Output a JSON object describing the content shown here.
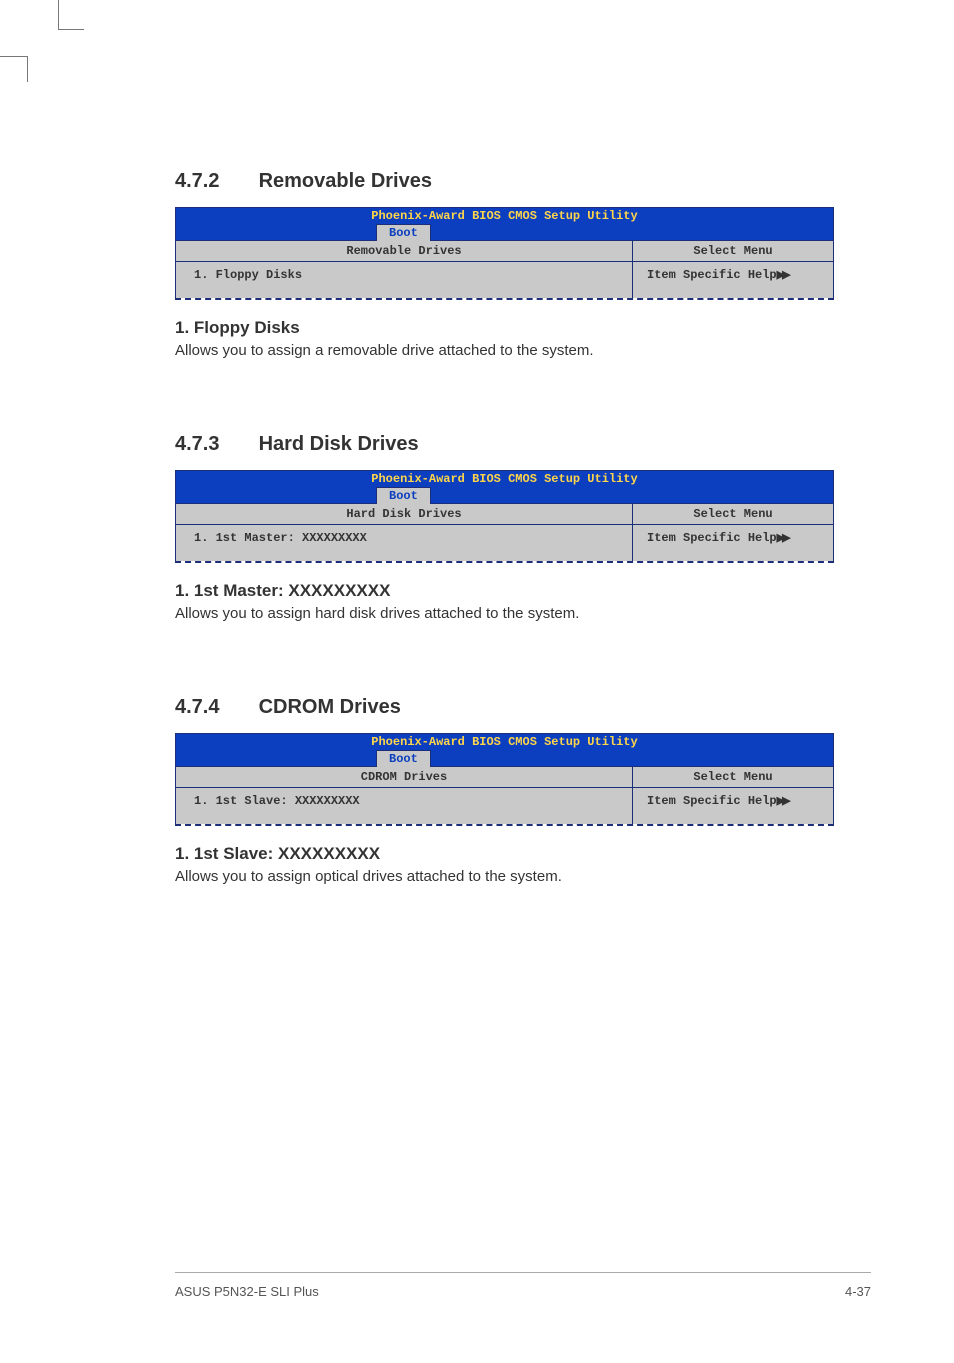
{
  "section472": {
    "number": "4.7.2",
    "title": "Removable Drives",
    "bios": {
      "title": "Phoenix-Award BIOS CMOS Setup Utility",
      "tab": "Boot",
      "left_header": "Removable Drives",
      "right_header": "Select Menu",
      "left_body": "1. Floppy Disks",
      "right_body": "Item Specific Help"
    },
    "sub_heading": "1. Floppy Disks",
    "sub_text": "Allows you to assign a removable drive attached to the system."
  },
  "section473": {
    "number": "4.7.3",
    "title": "Hard Disk Drives",
    "bios": {
      "title": "Phoenix-Award BIOS CMOS Setup Utility",
      "tab": "Boot",
      "left_header": "Hard Disk Drives",
      "right_header": "Select Menu",
      "left_body": "1. 1st Master: XXXXXXXXX",
      "right_body": "Item Specific Help"
    },
    "sub_heading": "1. 1st Master: XXXXXXXXX",
    "sub_text": "Allows you to assign hard disk drives attached to the system."
  },
  "section474": {
    "number": "4.7.4",
    "title": "CDROM Drives",
    "bios": {
      "title": "Phoenix-Award BIOS CMOS Setup Utility",
      "tab": "Boot",
      "left_header": "CDROM Drives",
      "right_header": "Select Menu",
      "left_body": "1. 1st Slave: XXXXXXXXX",
      "right_body": "Item Specific Help"
    },
    "sub_heading": "1. 1st Slave: XXXXXXXXX",
    "sub_text": "Allows you to assign optical drives attached to the system."
  },
  "footer": {
    "left": "ASUS P5N32-E SLI Plus",
    "right": "4-37"
  }
}
